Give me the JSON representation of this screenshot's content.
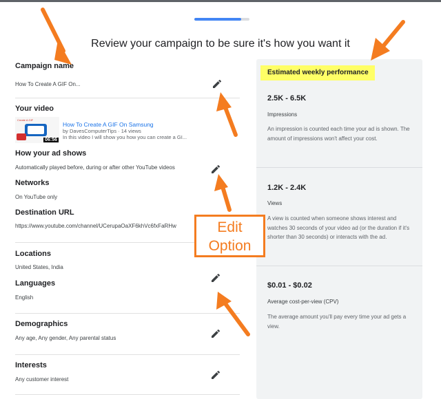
{
  "progress": {
    "fraction": 0.85
  },
  "page_title": "Review your campaign to be sure it's how you want it",
  "sections": {
    "campaign_name": {
      "title": "Campaign name",
      "value": "How To Create A GIF On..."
    },
    "your_video": {
      "title": "Your video",
      "video_title": "How To Create A GIF On Samsung",
      "meta": "by DavesComputerTips · 14 views",
      "description": "In this video I will show you how you can create a GI...",
      "duration": "06:56",
      "thumb_text": "Create A GIF"
    },
    "how_ad_shows": {
      "title": "How your ad shows",
      "value": "Automatically played before, during or after other YouTube videos"
    },
    "networks": {
      "title": "Networks",
      "value": "On YouTube only"
    },
    "destination_url": {
      "title": "Destination URL",
      "value": "https://www.youtube.com/channel/UCerupaOaXF6khVc6fxFaRHw"
    },
    "locations": {
      "title": "Locations",
      "value": "United States, India"
    },
    "languages": {
      "title": "Languages",
      "value": "English"
    },
    "demographics": {
      "title": "Demographics",
      "value": "Any age, Any gender, Any parental status"
    },
    "interests": {
      "title": "Interests",
      "value": "Any customer interest"
    }
  },
  "performance": {
    "header": "Estimated weekly performance",
    "highlight_color": "#ffff66",
    "metrics": [
      {
        "value": "2.5K - 6.5K",
        "label": "Impressions",
        "desc": "An impression is counted each time your ad is shown. The amount of impressions won't affect your cost."
      },
      {
        "value": "1.2K - 2.4K",
        "label": "Views",
        "desc": "A view is counted when someone shows interest and watches 30 seconds of your video ad (or the duration if it's shorter than 30 seconds) or interacts with the ad."
      },
      {
        "value": "$0.01 - $0.02",
        "label": "Average cost-per-view (CPV)",
        "desc": "The average amount you'll pay every time your ad gets a view."
      }
    ]
  },
  "annotation": {
    "line1": "Edit",
    "line2": "Option",
    "color": "#f47c20"
  },
  "icons": {
    "edit": "pencil-icon"
  },
  "colors": {
    "accent": "#4285f4",
    "link": "#1a73e8",
    "panel": "#f1f3f4"
  }
}
